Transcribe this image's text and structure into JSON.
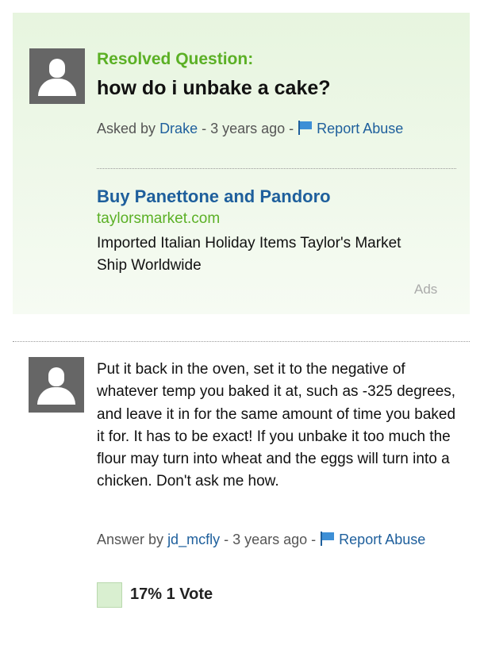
{
  "question": {
    "status_label": "Resolved Question:",
    "title": "how do i unbake a cake?",
    "meta": {
      "prefix": "Asked by",
      "user": "Drake",
      "time": "- 3 years ago -",
      "report_label": "Report Abuse"
    }
  },
  "ad": {
    "title": "Buy Panettone and Pandoro",
    "url": "taylorsmarket.com",
    "description": "Imported Italian Holiday Items Taylor's Market Ship Worldwide",
    "label": "Ads"
  },
  "answer": {
    "text": "Put it back in the oven, set it to the negative of whatever temp you baked it at, such as -325 degrees, and leave it in for the same amount of time you baked it for. It has to be exact! If you unbake it too much the flour may turn into wheat and the eggs will turn into a chicken. Don't ask me how.",
    "meta": {
      "prefix": "Answer by",
      "user": "jd_mcfly",
      "time": "- 3 years ago -",
      "report_label": "Report Abuse"
    },
    "votes": "17% 1 Vote"
  },
  "colors": {
    "resolved_green": "#5bb025",
    "link_blue": "#1e5f9c",
    "panel_green": "#e7f5df"
  }
}
